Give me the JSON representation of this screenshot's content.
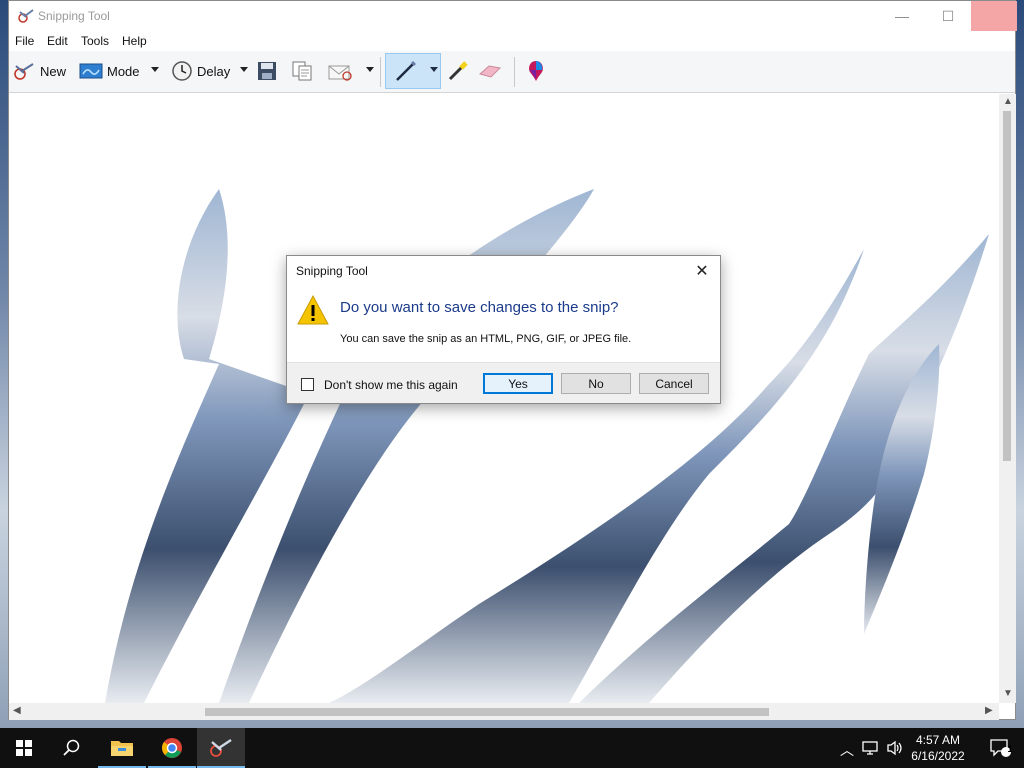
{
  "window": {
    "title": "Snipping Tool",
    "controls": {
      "minimize": "—",
      "maximize": "☐",
      "close": "✕"
    }
  },
  "menu": [
    "File",
    "Edit",
    "Tools",
    "Help"
  ],
  "toolbar": {
    "new_label": "New",
    "mode_label": "Mode",
    "delay_label": "Delay",
    "icons": [
      "new-snip-icon",
      "mode-icon",
      "clock-icon",
      "save-icon",
      "copy-icon",
      "send-email-icon",
      "pen-icon",
      "highlighter-icon",
      "eraser-icon",
      "paint3d-icon"
    ]
  },
  "dialog": {
    "title": "Snipping Tool",
    "heading": "Do you want to save changes to the snip?",
    "message": "You can save the snip as an HTML, PNG, GIF, or JPEG file.",
    "checkbox_label": "Don't show me this again",
    "checkbox_checked": false,
    "yes": "Yes",
    "no": "No",
    "cancel": "Cancel",
    "close_glyph": "✕"
  },
  "taskbar": {
    "time": "4:57 AM",
    "date": "6/16/2022",
    "notification_count": "1",
    "apps": [
      "start-icon",
      "search-icon",
      "file-explorer-icon",
      "chrome-icon",
      "snipping-tool-icon"
    ]
  },
  "colors": {
    "dialog_heading": "#1b3b8a",
    "default_button_border": "#0078d7",
    "taskbar": "#101010"
  }
}
